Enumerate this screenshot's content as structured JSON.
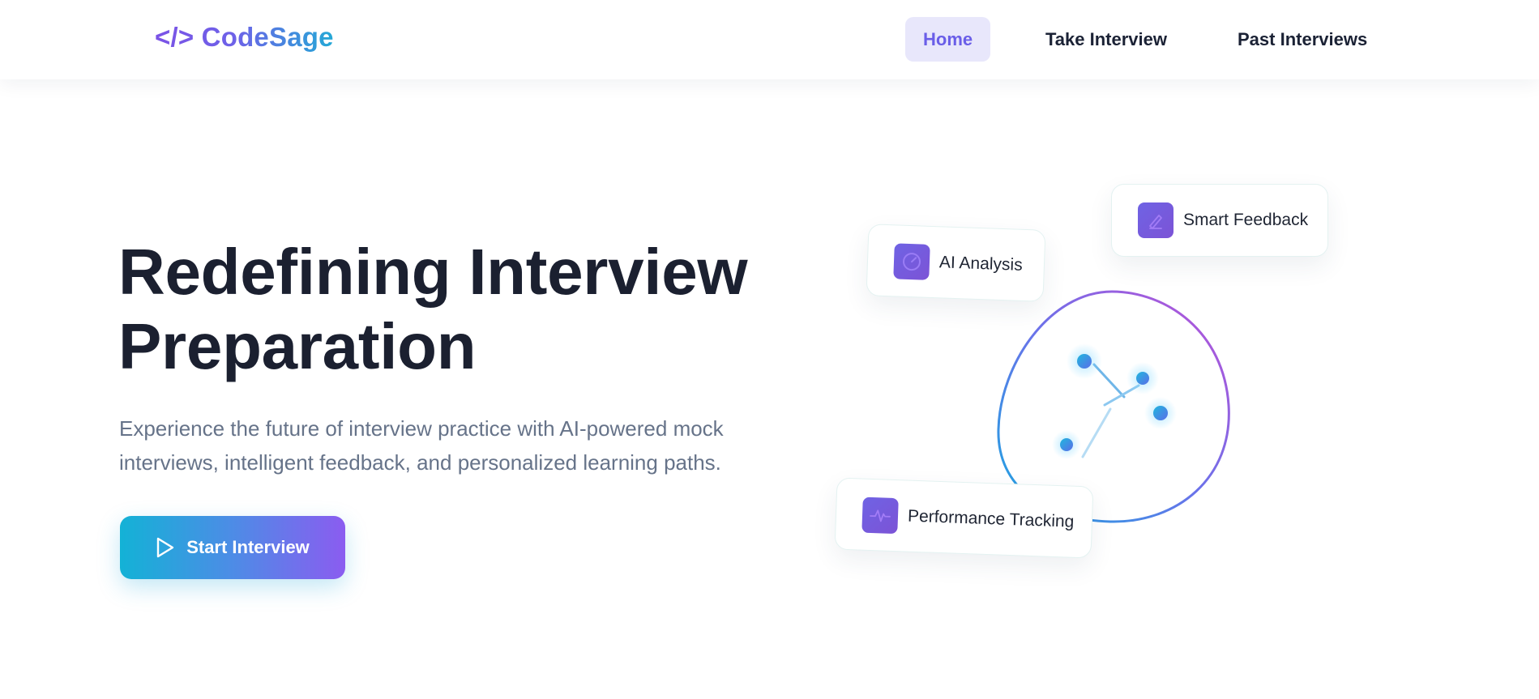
{
  "header": {
    "logo": "</> CodeSage",
    "nav": [
      {
        "label": "Home",
        "active": true
      },
      {
        "label": "Take Interview",
        "active": false
      },
      {
        "label": "Past Interviews",
        "active": false
      }
    ]
  },
  "hero": {
    "title_line1": "Redefining Interview",
    "title_line2": "Preparation",
    "subtitle": "Experience the future of interview practice with AI-powered mock interviews, intelligent feedback, and personalized learning paths.",
    "cta_label": "Start Interview",
    "cta_icon": "play-icon"
  },
  "features": {
    "ai_analysis": {
      "label": "AI Analysis",
      "icon": "gauge-icon"
    },
    "smart_feedback": {
      "label": "Smart Feedback",
      "icon": "pen-icon"
    },
    "performance_tracking": {
      "label": "Performance Tracking",
      "icon": "pulse-icon"
    }
  },
  "colors": {
    "brand_purple": "#6a5ee8",
    "brand_cyan": "#13b2d6",
    "icon_tile": "#7259dd",
    "title_text": "#1b2030",
    "subtitle_text": "#667389"
  }
}
